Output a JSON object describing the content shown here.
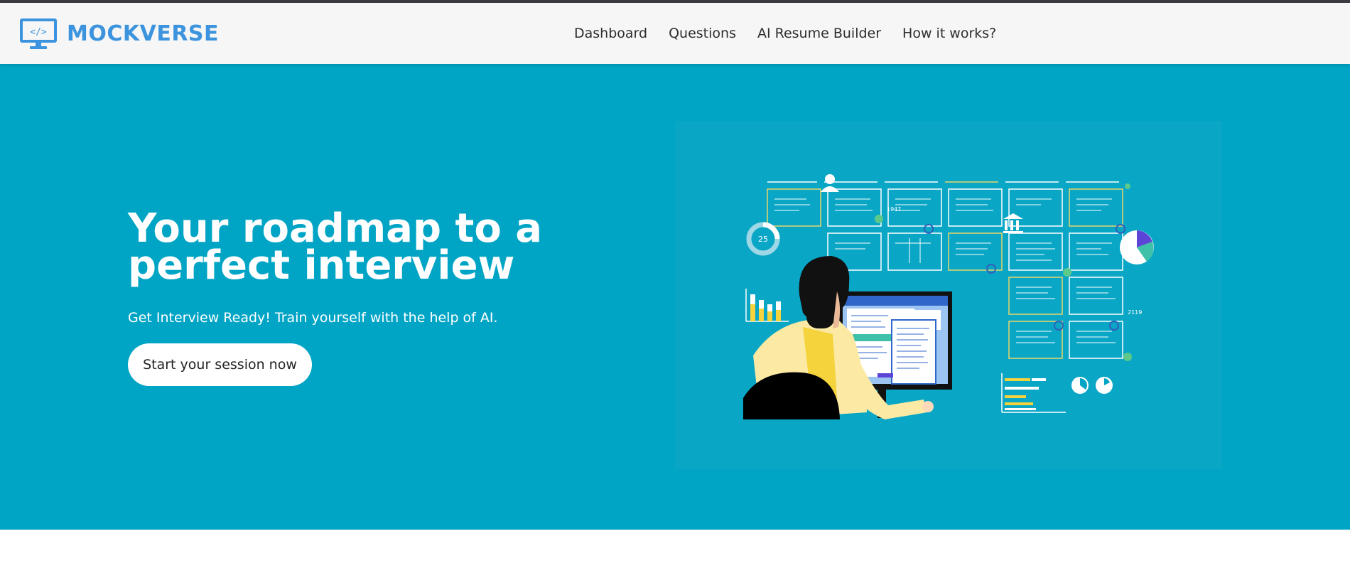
{
  "brand": {
    "name": "MOCKVERSE",
    "icon": "monitor-code-icon",
    "icon_glyph": "</>"
  },
  "nav": {
    "items": [
      {
        "label": "Dashboard"
      },
      {
        "label": "Questions"
      },
      {
        "label": "AI Resume Builder"
      },
      {
        "label": "How it works?"
      }
    ]
  },
  "hero": {
    "title": "Your roadmap to a perfect interview",
    "subtitle": "Get Interview Ready! Train yourself with the help of AI.",
    "cta_label": "Start your session now"
  },
  "illustration": {
    "ring_number": "25",
    "label_a": "1947",
    "label_b": "2119"
  },
  "colors": {
    "brand": "#3d94de",
    "hero_bg": "#00a4c5",
    "navbar_bg": "#f6f6f6",
    "accent_yellow": "#f5d33c"
  }
}
